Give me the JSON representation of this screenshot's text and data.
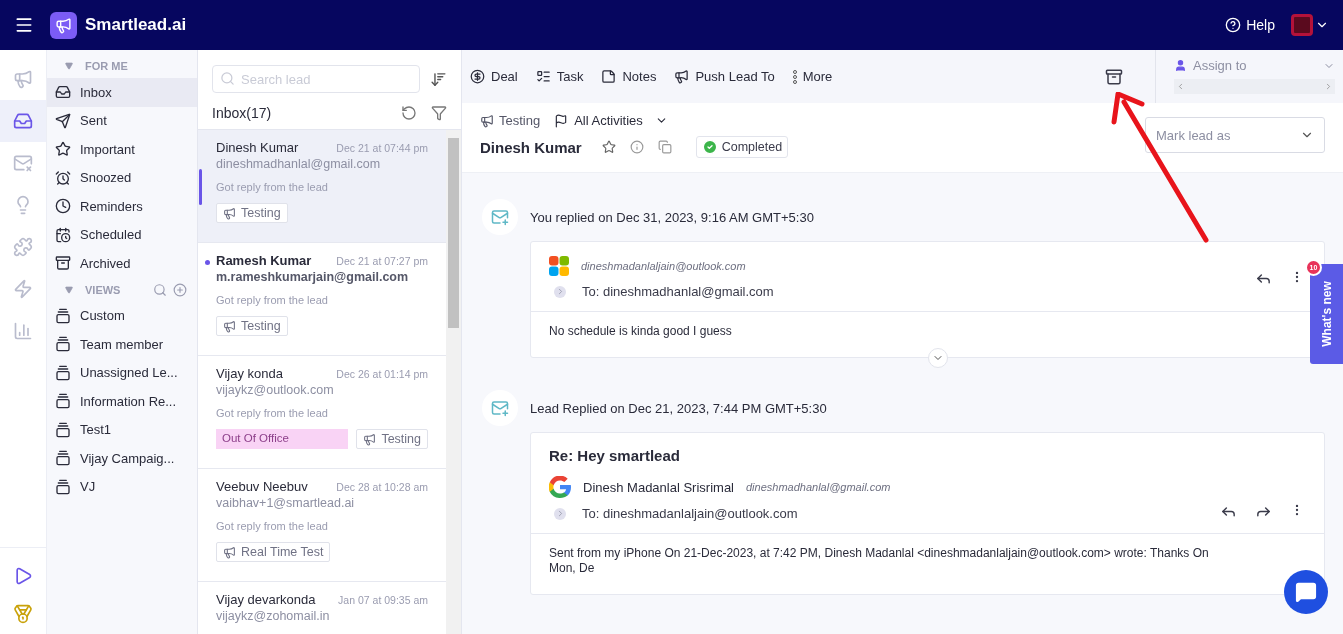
{
  "topbar": {
    "brand": "Smartlead.ai",
    "help": "Help"
  },
  "rail": {
    "items": [
      {
        "selected": false
      },
      {
        "selected": true
      },
      {
        "selected": false
      },
      {
        "selected": false
      },
      {
        "selected": false
      },
      {
        "selected": false
      },
      {
        "selected": false
      }
    ]
  },
  "nav": {
    "sections": [
      {
        "title": "FOR ME",
        "expanded": true,
        "items": [
          {
            "label": "Inbox",
            "selected": true
          },
          {
            "label": "Sent",
            "selected": false
          },
          {
            "label": "Important",
            "selected": false
          },
          {
            "label": "Snoozed",
            "selected": false
          },
          {
            "label": "Reminders",
            "selected": false
          },
          {
            "label": "Scheduled",
            "selected": false
          },
          {
            "label": "Archived",
            "selected": false
          }
        ]
      },
      {
        "title": "VIEWS",
        "expanded": true,
        "items": [
          {
            "label": "Custom",
            "selected": false
          },
          {
            "label": "Team member",
            "selected": false
          },
          {
            "label": "Unassigned Le...",
            "selected": false
          },
          {
            "label": "Information Re...",
            "selected": false
          },
          {
            "label": "Test1",
            "selected": false
          },
          {
            "label": "Vijay Campaig...",
            "selected": false
          },
          {
            "label": "VJ",
            "selected": false
          }
        ]
      }
    ]
  },
  "leads": {
    "search": {
      "placeholder": "Search lead"
    },
    "title": "Inbox(17)",
    "items": [
      {
        "name": "Dinesh Kumar",
        "date": "Dec 21 at 07:44 pm",
        "email": "dineshmadhanlal@gmail.com",
        "snippet": "Got reply from the lead",
        "unread": false,
        "selected": true,
        "tags": [
          {
            "kind": "campaign",
            "label": "Testing"
          }
        ]
      },
      {
        "name": "Ramesh Kumar",
        "date": "Dec 21 at 07:27 pm",
        "email": "m.rameshkumarjain@gmail.com",
        "snippet": "Got reply from the lead",
        "unread": true,
        "selected": false,
        "tags": [
          {
            "kind": "campaign",
            "label": "Testing"
          }
        ]
      },
      {
        "name": "Vijay konda",
        "date": "Dec 26 at 01:14 pm",
        "email": "vijaykz@outlook.com",
        "snippet": "Got reply from the lead",
        "unread": false,
        "selected": false,
        "tags": [
          {
            "kind": "category",
            "label": "Out Of Office",
            "color": "#f9d3f5"
          },
          {
            "kind": "campaign",
            "label": "Testing"
          }
        ]
      },
      {
        "name": "Veebuv Neebuv",
        "date": "Dec 28 at 10:28 am",
        "email": "vaibhav+1@smartlead.ai",
        "snippet": "Got reply from the lead",
        "unread": false,
        "selected": false,
        "tags": [
          {
            "kind": "campaign",
            "label": "Real Time Test"
          }
        ]
      },
      {
        "name": "Vijay devarkonda",
        "date": "Jan 07 at 09:35 am",
        "email": "vijaykz@zohomail.in",
        "unread": false,
        "selected": false
      }
    ]
  },
  "toolbar": {
    "actions": [
      {
        "label": "Deal"
      },
      {
        "label": "Task"
      },
      {
        "label": "Notes"
      },
      {
        "label": "Push Lead To"
      },
      {
        "label": "More"
      }
    ],
    "assign": "Assign to",
    "mark": {
      "placeholder": "Mark lead as"
    }
  },
  "lead": {
    "campaign": "Testing",
    "filter": "All Activities",
    "name": "Dinesh Kumar",
    "status": "Completed"
  },
  "activities": [
    {
      "title": "You replied on Dec 31, 2023, 9:16 AM GMT+5:30",
      "from_email": "dineshmadanlaljain@outlook.com",
      "to": "To: dineshmadhanlal@gmail.com",
      "body": "No schedule is kinda good I guess"
    },
    {
      "title": "Lead Replied on Dec 21, 2023, 7:44 PM GMT+5:30",
      "subject": "Re: Hey smartlead",
      "from_name": "Dinesh Madanlal Srisrimal",
      "from_email": "dineshmadhanlal@gmail.com",
      "to": "To: dineshmadanlaljain@outlook.com",
      "body": "Sent from my iPhone On 21-Dec-2023, at 7:42 PM, Dinesh Madanlal <dineshmadanlaljain@outlook.com> wrote:  Thanks On Mon, De"
    }
  ],
  "whats_new": {
    "label": "What's new",
    "badge": "10"
  }
}
